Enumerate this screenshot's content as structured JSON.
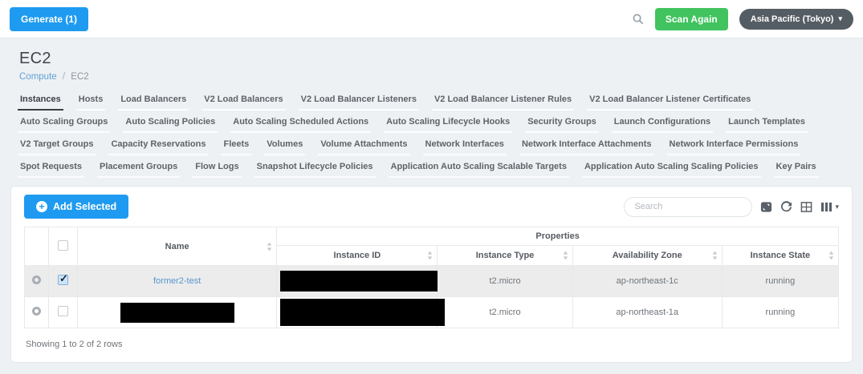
{
  "topbar": {
    "generate_label": "Generate (1)",
    "scan_again_label": "Scan Again",
    "region_label": "Asia Pacific (Tokyo)",
    "caret": "▾"
  },
  "header": {
    "title": "EC2",
    "breadcrumb": {
      "parent": "Compute",
      "separator": "/",
      "current": "EC2"
    }
  },
  "tabs": {
    "active": "Instances",
    "items": [
      "Instances",
      "Hosts",
      "Load Balancers",
      "V2 Load Balancers",
      "V2 Load Balancer Listeners",
      "V2 Load Balancer Listener Rules",
      "V2 Load Balancer Listener Certificates",
      "Auto Scaling Groups",
      "Auto Scaling Policies",
      "Auto Scaling Scheduled Actions",
      "Auto Scaling Lifecycle Hooks",
      "Security Groups",
      "Launch Configurations",
      "Launch Templates",
      "V2 Target Groups",
      "Capacity Reservations",
      "Fleets",
      "Volumes",
      "Volume Attachments",
      "Network Interfaces",
      "Network Interface Attachments",
      "Network Interface Permissions",
      "Spot Requests",
      "Placement Groups",
      "Flow Logs",
      "Snapshot Lifecycle Policies",
      "Application Auto Scaling Scalable Targets",
      "Application Auto Scaling Scaling Policies",
      "Key Pairs"
    ]
  },
  "toolbar": {
    "add_selected_label": "Add Selected",
    "search_placeholder": "Search",
    "icons": [
      "fullscreen-icon",
      "refresh-icon",
      "toggle-view-icon",
      "columns-dropdown-icon"
    ]
  },
  "table": {
    "group_header": "Properties",
    "columns": [
      "Name",
      "Instance ID",
      "Instance Type",
      "Availability Zone",
      "Instance State"
    ],
    "rows": [
      {
        "selected": true,
        "checked": true,
        "name": "former2-test",
        "name_redacted": false,
        "instance_id_redacted": true,
        "instance_type": "t2.micro",
        "availability_zone": "ap-northeast-1c",
        "instance_state": "running"
      },
      {
        "selected": false,
        "checked": false,
        "name": "",
        "name_redacted": true,
        "instance_id_redacted": true,
        "instance_type": "t2.micro",
        "availability_zone": "ap-northeast-1a",
        "instance_state": "running"
      }
    ],
    "footer": "Showing 1 to 2 of 2 rows"
  },
  "colors": {
    "primary_blue": "#1e9bf0",
    "success_green": "#41c35f",
    "region_pill": "#555d64",
    "page_background": "#eef1f4",
    "selected_row": "#ececec",
    "link_blue": "#5795cf",
    "active_tab": "#383f45",
    "redaction": "#000000"
  }
}
